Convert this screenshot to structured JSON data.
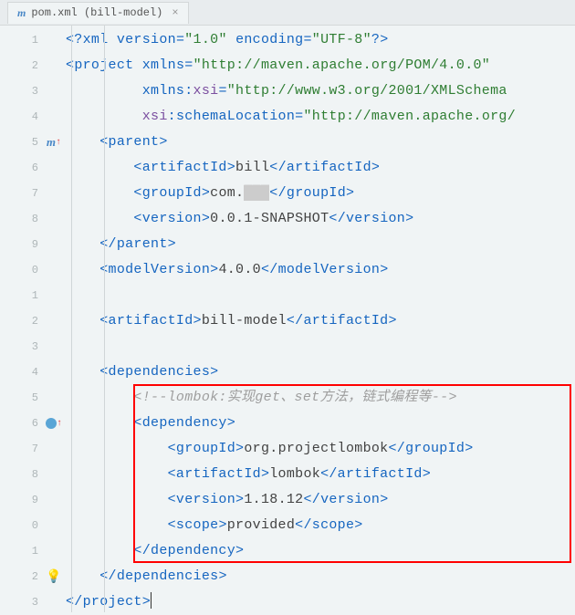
{
  "tab": {
    "filename": "pom.xml (bill-model)",
    "close": "×"
  },
  "gutter": {
    "lines": [
      "1",
      "2",
      "3",
      "4",
      "5",
      "6",
      "7",
      "8",
      "9",
      "0",
      "1",
      "2",
      "3",
      "4",
      "5",
      "6",
      "7",
      "8",
      "9",
      "0",
      "1",
      "2",
      "3"
    ]
  },
  "xml": {
    "decl_open": "<?",
    "decl_xml": "xml",
    "decl_version_attr": " version",
    "decl_eq": "=",
    "decl_version_val": "\"1.0\"",
    "decl_encoding_attr": " encoding",
    "decl_encoding_val": "\"UTF-8\"",
    "decl_close": "?>",
    "project_open": "<",
    "project_tag": "project",
    "xmlns_attr": " xmlns",
    "xmlns_val": "\"http://maven.apache.org/POM/4.0.0\"",
    "xmlns_xsi_prefix": "         xmlns:",
    "xsi": "xsi",
    "xsi_val": "\"http://www.w3.org/2001/XMLSchema",
    "schema_prefix": "         ",
    "xsi_ns": "xsi",
    "schema_colon": ":",
    "schema_attr": "schemaLocation",
    "schema_val": "\"http://maven.apache.org/",
    "parent_open": "    <",
    "parent": "parent",
    "close_gt": ">",
    "artifactId_open": "        <",
    "artifactId": "artifactId",
    "bill": "bill",
    "close_tag_open": "</",
    "groupId_open": "        <",
    "groupId": "groupId",
    "com": "com.",
    "redact": "███",
    "version_open": "        <",
    "version": "version",
    "snapshot": "0.0.1-SNAPSHOT",
    "parent_close": "    </",
    "modelVersion_open": "    <",
    "modelVersion": "modelVersion",
    "mv_val": "4.0.0",
    "artifactId_main_open": "    <",
    "billmodel": "bill-model",
    "deps_open": "    <",
    "dependencies": "dependencies",
    "comment_prefix": "        ",
    "comment": "<!--lombok:实现get、set方法，链式编程等-->",
    "dep_open": "        <",
    "dependency": "dependency",
    "dep_groupId_open": "            <",
    "lombok_group": "org.projectlombok",
    "dep_artifactId_open": "            <",
    "lombok": "lombok",
    "dep_version_open": "            <",
    "lombok_ver": "1.18.12",
    "scope_open": "            <",
    "scope": "scope",
    "provided": "provided",
    "dep_close": "        </",
    "deps_close": "    </",
    "project_close": "</"
  }
}
